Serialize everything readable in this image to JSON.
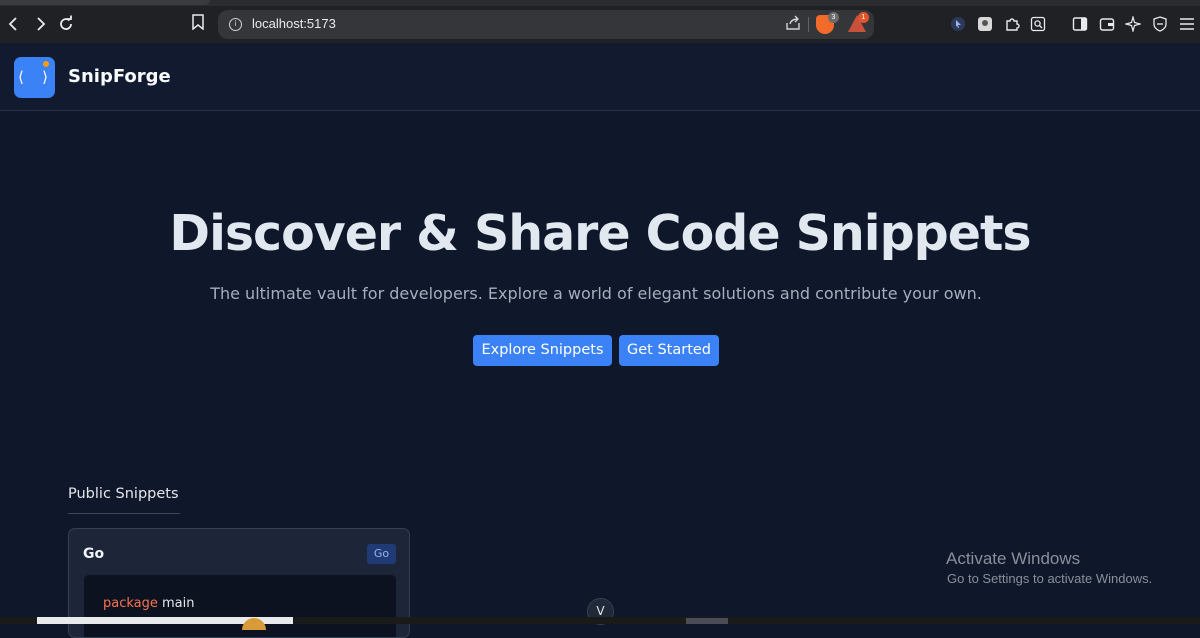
{
  "browser": {
    "url": "localhost:5173",
    "brave_badge_count": "3",
    "rewards_badge_count": "1",
    "icons": {
      "back": "chevron-left-icon",
      "forward": "chevron-right-icon",
      "reload": "reload-icon",
      "bookmark": "bookmark-icon",
      "site_info": "info-icon",
      "share": "share-icon",
      "extensions": [
        "cursor-extension-icon",
        "image-extension-icon",
        "puzzle-extension-icon",
        "search-extension-icon",
        "sidebar-icon",
        "wallet-icon",
        "leo-ai-icon",
        "vpn-shield-icon",
        "menu-icon"
      ]
    }
  },
  "app": {
    "brand_name": "SnipForge",
    "logo_glyph": "⟨ ⟩",
    "accent_color": "#3b82f6"
  },
  "hero": {
    "title": "Discover & Share Code Snippets",
    "subtitle": "The ultimate vault for developers. Explore a world of elegant solutions and contribute your own.",
    "primary_button": "Explore Snippets",
    "secondary_button": "Get Started"
  },
  "snippets": {
    "section_title": "Public Snippets",
    "cards": [
      {
        "title": "Go",
        "language_badge": "Go",
        "code_keyword": "package",
        "code_rest": " main"
      }
    ]
  },
  "overlay": {
    "scroll_down": "V",
    "activate_title": "Activate Windows",
    "activate_subtitle": "Go to Settings to activate Windows."
  }
}
